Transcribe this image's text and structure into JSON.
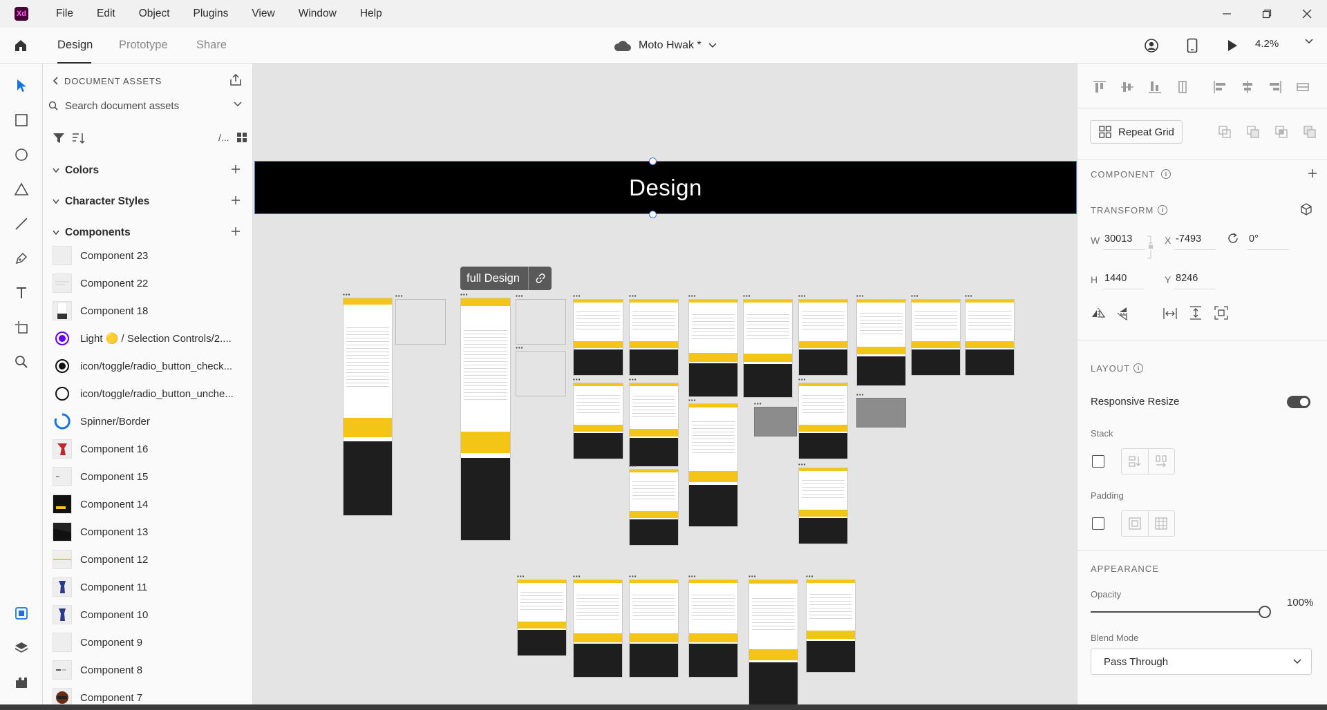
{
  "app": {
    "logo_text": "Xd",
    "accent": "#470137",
    "logo_color": "#ff61f6"
  },
  "menu": [
    "File",
    "Edit",
    "Object",
    "Plugins",
    "View",
    "Window",
    "Help"
  ],
  "header": {
    "tabs": [
      {
        "label": "Design",
        "active": true
      },
      {
        "label": "Prototype",
        "active": false
      },
      {
        "label": "Share",
        "active": false
      }
    ],
    "document_title": "Moto Hwak *",
    "zoom": "4.2%"
  },
  "assets": {
    "title": "DOCUMENT ASSETS",
    "search_placeholder": "Search document assets",
    "view_toggle": "/...",
    "sections": {
      "colors": "Colors",
      "character_styles": "Character Styles",
      "components": "Components"
    },
    "components": [
      {
        "name": "Component 23",
        "thumb": "blank"
      },
      {
        "name": "Component 22",
        "thumb": "lines"
      },
      {
        "name": "Component 18",
        "thumb": "page"
      },
      {
        "name": "Light 🟡 / Selection Controls/2....",
        "thumb": "radio-purple"
      },
      {
        "name": "icon/toggle/radio_button_check...",
        "thumb": "radio-checked"
      },
      {
        "name": "icon/toggle/radio_button_unche...",
        "thumb": "radio-unchecked"
      },
      {
        "name": "Spinner/Border",
        "thumb": "spinner"
      },
      {
        "name": "Component 16",
        "thumb": "red"
      },
      {
        "name": "Component 15",
        "thumb": "dot"
      },
      {
        "name": "Component 14",
        "thumb": "dark-yellow"
      },
      {
        "name": "Component 13",
        "thumb": "dark"
      },
      {
        "name": "Component 12",
        "thumb": "yellow-line"
      },
      {
        "name": "Component 11",
        "thumb": "blue-figure"
      },
      {
        "name": "Component 10",
        "thumb": "blue-figure"
      },
      {
        "name": "Component 9",
        "thumb": "blank"
      },
      {
        "name": "Component 8",
        "thumb": "dash"
      },
      {
        "name": "Component 7",
        "thumb": "helmet"
      }
    ]
  },
  "canvas": {
    "banner_text": "Design",
    "artboard_tag": "full Design",
    "selection_color": "#3a7bd5",
    "brand_yellow": "#f2c516"
  },
  "inspector": {
    "repeat_grid": "Repeat Grid",
    "component_label": "COMPONENT",
    "transform_label": "TRANSFORM",
    "transform": {
      "w": "30013",
      "h": "1440",
      "x": "-7493",
      "y": "8246",
      "rotation": "0°"
    },
    "field_labels": {
      "w": "W",
      "h": "H",
      "x": "X",
      "y": "Y"
    },
    "layout_label": "LAYOUT",
    "responsive_resize": "Responsive Resize",
    "responsive_resize_on": true,
    "stack_label": "Stack",
    "padding_label": "Padding",
    "appearance_label": "APPEARANCE",
    "opacity_label": "Opacity",
    "opacity": "100%",
    "blend_mode_label": "Blend Mode",
    "blend_mode": "Pass Through"
  }
}
